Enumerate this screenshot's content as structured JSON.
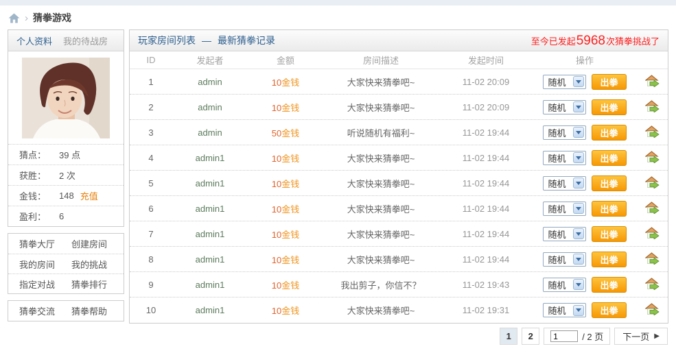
{
  "colors": {
    "accent_blue": "#2d5e8e",
    "announce_red": "#ff1e1e",
    "money_number": "#e2622a",
    "money_unit": "#f0941f",
    "button_orange": "#f79804",
    "recharge_orange": "#e8820c"
  },
  "breadcrumb": {
    "home_icon": "home-icon",
    "separator": "›",
    "title": "猜拳游戏"
  },
  "sidebar": {
    "tabs": [
      {
        "label": "个人资料"
      },
      {
        "label": "我的待战房"
      }
    ],
    "stats": [
      {
        "label": "猜点：",
        "value": "39 点"
      },
      {
        "label": "获胜：",
        "value": "2 次"
      },
      {
        "label": "金钱：",
        "value": "148",
        "link": "充值"
      },
      {
        "label": "盈利：",
        "value": "6"
      }
    ],
    "menu1": [
      [
        "猜拳大厅",
        "创建房间"
      ],
      [
        "我的房间",
        "我的挑战"
      ],
      [
        "指定对战",
        "猜拳排行"
      ]
    ],
    "menu2": [
      [
        "猜拳交流",
        "猜拳帮助"
      ]
    ]
  },
  "main": {
    "title_left": "玩家房间列表",
    "title_sep": "—",
    "title_right": "最新猜拳记录",
    "announcement": {
      "prefix": "至今已发起",
      "count": "5968",
      "suffix": "次猜拳挑战了"
    },
    "table": {
      "headers": [
        "ID",
        "发起者",
        "金额",
        "房间描述",
        "发起时间",
        "操作"
      ],
      "rows": [
        {
          "id": "1",
          "initiator": "admin",
          "amount_num": "10",
          "amount_unit": "金钱",
          "desc": "大家快来猜拳吧~",
          "time": "11-02 20:09",
          "select": "随机",
          "action": "出拳"
        },
        {
          "id": "2",
          "initiator": "admin",
          "amount_num": "10",
          "amount_unit": "金钱",
          "desc": "大家快来猜拳吧~",
          "time": "11-02 20:09",
          "select": "随机",
          "action": "出拳"
        },
        {
          "id": "3",
          "initiator": "admin",
          "amount_num": "50",
          "amount_unit": "金钱",
          "desc": "听说随机有福利~",
          "time": "11-02 19:44",
          "select": "随机",
          "action": "出拳"
        },
        {
          "id": "4",
          "initiator": "admin1",
          "amount_num": "10",
          "amount_unit": "金钱",
          "desc": "大家快来猜拳吧~",
          "time": "11-02 19:44",
          "select": "随机",
          "action": "出拳"
        },
        {
          "id": "5",
          "initiator": "admin1",
          "amount_num": "10",
          "amount_unit": "金钱",
          "desc": "大家快来猜拳吧~",
          "time": "11-02 19:44",
          "select": "随机",
          "action": "出拳"
        },
        {
          "id": "6",
          "initiator": "admin1",
          "amount_num": "10",
          "amount_unit": "金钱",
          "desc": "大家快来猜拳吧~",
          "time": "11-02 19:44",
          "select": "随机",
          "action": "出拳"
        },
        {
          "id": "7",
          "initiator": "admin1",
          "amount_num": "10",
          "amount_unit": "金钱",
          "desc": "大家快来猜拳吧~",
          "time": "11-02 19:44",
          "select": "随机",
          "action": "出拳"
        },
        {
          "id": "8",
          "initiator": "admin1",
          "amount_num": "10",
          "amount_unit": "金钱",
          "desc": "大家快来猜拳吧~",
          "time": "11-02 19:44",
          "select": "随机",
          "action": "出拳"
        },
        {
          "id": "9",
          "initiator": "admin1",
          "amount_num": "10",
          "amount_unit": "金钱",
          "desc": "我出剪子，你信不？",
          "time": "11-02 19:43",
          "select": "随机",
          "action": "出拳"
        },
        {
          "id": "10",
          "initiator": "admin1",
          "amount_num": "10",
          "amount_unit": "金钱",
          "desc": "大家快来猜拳吧~",
          "time": "11-02 19:31",
          "select": "随机",
          "action": "出拳"
        }
      ]
    },
    "pagination": {
      "page1": "1",
      "page2": "2",
      "input_value": "1",
      "total_label": "/ 2 页",
      "next_label": "下一页",
      "next_icon": "▶"
    }
  }
}
